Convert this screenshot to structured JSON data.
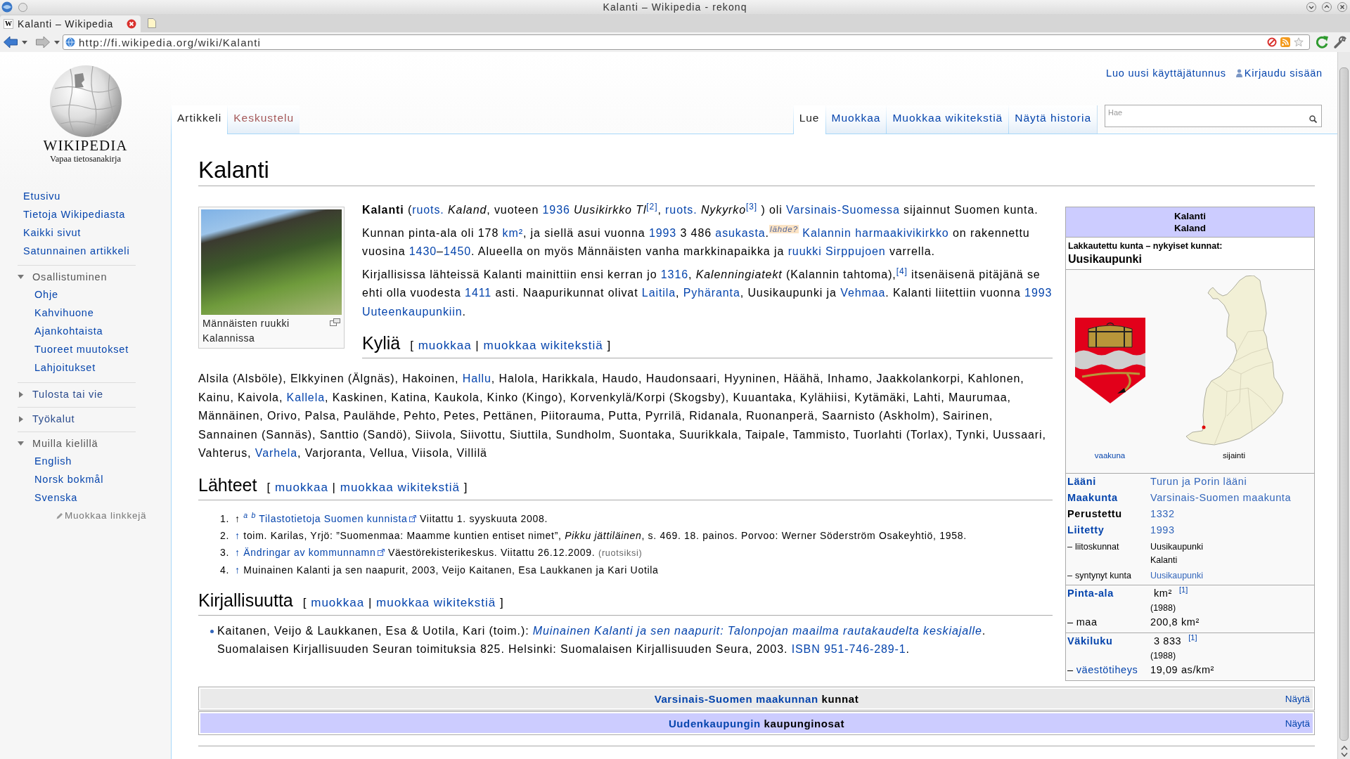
{
  "window": {
    "title": "Kalanti – Wikipedia - rekonq"
  },
  "browser_tabs": [
    {
      "icon": "W",
      "title": "Kalanti – Wikipedia",
      "selected": true
    }
  ],
  "address_bar": {
    "url": "http://fi.wikipedia.org/wiki/Kalanti"
  },
  "logo": {
    "wordmark": "WIKIPEDIA",
    "tagline": "Vapaa tietosanakirja"
  },
  "sidebar": {
    "links": [
      "Etusivu",
      "Tietoja Wikipediasta",
      "Kaikki sivut",
      "Satunnainen artikkeli"
    ],
    "sections": [
      {
        "title": "Osallistuminen",
        "expanded": true,
        "items": [
          "Ohje",
          "Kahvihuone",
          "Ajankohtaista",
          "Tuoreet muutokset",
          "Lahjoitukset"
        ]
      },
      {
        "title": "Tulosta tai vie",
        "expanded": false
      },
      {
        "title": "Työkalut",
        "expanded": false
      },
      {
        "title": "Muilla kielillä",
        "expanded": true,
        "items": [
          "English",
          "Norsk bokmål",
          "Svenska"
        ],
        "edit_link": "Muokkaa linkkejä"
      }
    ]
  },
  "personal_links": [
    {
      "kind": "plain",
      "label": "Luo uusi käyttäjätunnus"
    },
    {
      "kind": "user",
      "label": "Kirjaudu sisään"
    }
  ],
  "page_tabs": [
    {
      "label": "Artikkeli",
      "selected": true,
      "exists": true
    },
    {
      "label": "Keskustelu",
      "selected": false,
      "exists": false
    }
  ],
  "view_tabs": [
    {
      "label": "Lue",
      "selected": true
    },
    {
      "label": "Muokkaa",
      "selected": false
    },
    {
      "label": "Muokkaa wikitekstiä",
      "selected": false
    },
    {
      "label": "Näytä historia",
      "selected": false
    }
  ],
  "search": {
    "placeholder": "Hae"
  },
  "article": {
    "title": "Kalanti",
    "figure": {
      "caption": "Männäisten ruukki Kalannissa"
    },
    "intro": [
      [
        {
          "kind": "text",
          "text": "**Kalanti** ("
        },
        {
          "kind": "link",
          "text": "ruots."
        },
        {
          "kind": "text",
          "text": " *Kaland*, vuoteen "
        },
        {
          "kind": "link",
          "text": "1936"
        },
        {
          "kind": "text",
          "text": " *Uusikirkko Tl*"
        },
        {
          "kind": "link",
          "text": "$^{[2]}$"
        },
        {
          "kind": "text",
          "text": ", "
        },
        {
          "kind": "link",
          "text": "ruots."
        },
        {
          "kind": "text",
          "text": " *Nykyrko*"
        },
        {
          "kind": "link",
          "text": "$^{[3]}$"
        },
        {
          "kind": "text",
          "text": " ) oli "
        },
        {
          "kind": "link",
          "text": "Varsinais-Suomessa"
        },
        {
          "kind": "text",
          "text": " sijainnut Suomen kunta."
        }
      ],
      [
        {
          "kind": "text",
          "text": "Kunnan pinta-ala oli 178 "
        },
        {
          "kind": "link",
          "text": "km²"
        },
        {
          "kind": "text",
          "text": ", ja siellä asui vuonna "
        },
        {
          "kind": "link",
          "text": "1993"
        },
        {
          "kind": "text",
          "text": " 3 486 "
        },
        {
          "kind": "link",
          "text": "asukasta"
        },
        {
          "kind": "text",
          "text": "."
        },
        {
          "kind": "tag",
          "text": "lähde?"
        },
        {
          "kind": "link",
          "text": "Kalannin harmaakivikirkko",
          "space_before": true
        },
        {
          "kind": "text",
          "text": " on rakennettu vuosina "
        },
        {
          "kind": "link",
          "text": "1430"
        },
        {
          "kind": "text",
          "text": "–"
        },
        {
          "kind": "link",
          "text": "1450"
        },
        {
          "kind": "text",
          "text": ". Alueella on myös Männäisten vanha markkinapaikka ja "
        },
        {
          "kind": "link",
          "text": "ruukki Sirppujoen"
        },
        {
          "kind": "text",
          "text": " varrella."
        }
      ],
      [
        {
          "kind": "text",
          "text": "Kirjallisissa lähteissä Kalanti mainittiin ensi kerran jo "
        },
        {
          "kind": "link",
          "text": "1316"
        },
        {
          "kind": "text",
          "text": ", *Kalenningiatekt* (Kalannin tahtoma),"
        },
        {
          "kind": "link",
          "text": "$^{[4]}$"
        },
        {
          "kind": "text",
          "text": " itsenäisenä pitäjänä se ehti olla vuodesta "
        },
        {
          "kind": "link",
          "text": "1411"
        },
        {
          "kind": "text",
          "text": " asti. Naapurikunnat olivat "
        },
        {
          "kind": "link",
          "text": "Laitila"
        },
        {
          "kind": "text",
          "text": ", "
        },
        {
          "kind": "link",
          "text": "Pyhäranta"
        },
        {
          "kind": "text",
          "text": ", Uusikaupunki ja "
        },
        {
          "kind": "link",
          "text": "Vehmaa"
        },
        {
          "kind": "text",
          "text": ". Kalanti liitettiin vuonna "
        },
        {
          "kind": "link",
          "text": "1993"
        },
        {
          "kind": "link",
          "text": "Uuteenkaupunkiin",
          "space_before": true
        },
        {
          "kind": "text",
          "text": "."
        }
      ]
    ],
    "sections": [
      {
        "heading": "Kyliä",
        "edit": [
          {
            "kind": "text",
            "text": "[ "
          },
          {
            "kind": "link",
            "text": "muokkaa"
          },
          {
            "kind": "text",
            "text": " | "
          },
          {
            "kind": "link",
            "text": "muokkaa wikitekstiä"
          },
          {
            "kind": "text",
            "text": " ]"
          }
        ],
        "kind": "paragraph",
        "content": [
          {
            "kind": "text",
            "text": "Alsila (Alsböle), Elkkyinen (Älgnäs), Hakoinen, "
          },
          {
            "kind": "link",
            "text": "Hallu"
          },
          {
            "kind": "text",
            "text": ", Halola, Harikkala, Haudo, Haudonsaari, Hyyninen, Häähä, Inhamo, Jaakkolankorpi, Kahlonen, Kainu, Kaivola, "
          },
          {
            "kind": "link",
            "text": "Kallela"
          },
          {
            "kind": "text",
            "text": ", Kaskinen, Katina, Kaukola, Kinko (Kingo), Korvenkylä/Korpi (Skogsby), Kuuantaka, Kylähiisi, Kytämäki, Lahti, Maurumaa, Männäinen, Orivo, Palsa, Paulähde, Pehto, Petes, Pettänen, Piitorauma, Putta, Pyrrilä, Ridanala, Ruonanperä, Saarnisto (Askholm), Sairinen, Sannainen (Sannäs), Santtio (Sandö), Siivola, Siivottu, Siuttila, Sundholm, Suontaka, Suurikkala, Taipale, Tammisto, Tuorlahti (Torlax), Tynki, Uussaari, Vahterus, "
          },
          {
            "kind": "link",
            "text": "Varhela"
          },
          {
            "kind": "text",
            "text": ", Varjoranta, Vellua, Viisola, Villilä"
          }
        ]
      },
      {
        "heading": "Lähteet",
        "edit": [
          {
            "kind": "text",
            "text": "[ "
          },
          {
            "kind": "link",
            "text": "muokkaa"
          },
          {
            "kind": "text",
            "text": " | "
          },
          {
            "kind": "link",
            "text": "muokkaa wikitekstiä"
          },
          {
            "kind": "text",
            "text": " ]"
          }
        ],
        "kind": "references",
        "items": [
          {
            "number": "1.",
            "segments": [
              {
                "kind": "text",
                "text": "↑ "
              },
              {
                "kind": "backlink",
                "text": "a"
              },
              {
                "kind": "backlink",
                "text": "b",
                "space_before": true
              },
              {
                "kind": "external",
                "text": "Tilastotietoja Suomen kunnista",
                "space_before": true
              },
              {
                "kind": "text",
                "text": " Viitattu 1. syyskuuta 2008."
              }
            ]
          },
          {
            "number": "2.",
            "segments": [
              {
                "kind": "link",
                "text": "↑"
              },
              {
                "kind": "text",
                "text": " toim. Karilas, Yrjö: ”Suomenmaa: Maamme kuntien entiset nimet”, *Pikku jättiläinen*, s. 469. 18. painos. Porvoo: Werner Söderström Osakeyhtiö, 1958."
              }
            ]
          },
          {
            "number": "3.",
            "segments": [
              {
                "kind": "link",
                "text": "↑"
              },
              {
                "kind": "external",
                "text": "Ändringar av kommunnamn",
                "space_before": true
              },
              {
                "kind": "text",
                "text": " Väestörekisterikeskus. Viitattu 26.12.2009. "
              },
              {
                "kind": "note",
                "text": "(ruotsiksi)"
              }
            ]
          },
          {
            "number": "4.",
            "segments": [
              {
                "kind": "link",
                "text": "↑"
              },
              {
                "kind": "text",
                "text": " Muinainen Kalanti ja sen naapurit, 2003, Veijo Kaitanen, Esa Laukkanen ja Kari Uotila"
              }
            ]
          }
        ]
      },
      {
        "heading": "Kirjallisuutta",
        "edit": [
          {
            "kind": "text",
            "text": "[ "
          },
          {
            "kind": "link",
            "text": "muokkaa"
          },
          {
            "kind": "text",
            "text": " | "
          },
          {
            "kind": "link",
            "text": "muokkaa wikitekstiä"
          },
          {
            "kind": "text",
            "text": " ]"
          }
        ],
        "kind": "bullets",
        "items": [
          [
            {
              "kind": "text",
              "text": "Kaitanen, Veijo & Laukkanen, Esa & Uotila, Kari (toim.): "
            },
            {
              "kind": "link",
              "text": "*Muinainen Kalanti ja sen naapurit: Talonpojan maailma rautakaudelta keskiajalle*"
            },
            {
              "kind": "text",
              "text": ". Suomalaisen Kirjallisuuden Seuran toimituksia 825. Helsinki: Suomalaisen Kirjallisuuden Seura, 2003. "
            },
            {
              "kind": "link",
              "text": "ISBN 951-746-289-1"
            },
            {
              "kind": "text",
              "text": "."
            }
          ]
        ]
      }
    ]
  },
  "infobox": {
    "title": "Kalanti",
    "subtitle": "Kaland",
    "status_label": "Lakkautettu kunta – nykyiset kunnat:",
    "status_value": "Uusikaupunki",
    "images": [
      {
        "kind": "coat-of-arms",
        "caption": "vaakuna",
        "caption_link": true
      },
      {
        "kind": "map",
        "caption": "sijainti",
        "caption_link": false
      }
    ],
    "groups": [
      [
        {
          "kind": "main",
          "label": "Lääni",
          "label_link": true,
          "values": [
            {
              "text": "Turun ja Porin lääni",
              "link": true
            }
          ]
        },
        {
          "kind": "main",
          "label": "Maakunta",
          "label_link": true,
          "values": [
            {
              "text": "Varsinais-Suomen maakunta",
              "link": true
            }
          ]
        },
        {
          "kind": "main",
          "label": "Perustettu",
          "label_link": false,
          "values": [
            {
              "text": "1332",
              "link": true
            }
          ]
        },
        {
          "kind": "main",
          "label": "Liitetty",
          "label_link": true,
          "values": [
            {
              "text": "1993",
              "link": true
            }
          ]
        },
        {
          "kind": "detail",
          "prefix": "–",
          "label": "liitoskunnat",
          "label_link": false,
          "values": [
            {
              "text": "Uusikaupunki",
              "link": false
            },
            {
              "text": "Kalanti",
              "link": false
            }
          ]
        },
        {
          "kind": "detail",
          "prefix": "–",
          "label": "syntynyt kunta",
          "label_link": false,
          "values": [
            {
              "text": "Uusikaupunki",
              "link": true
            }
          ]
        }
      ],
      [
        {
          "kind": "main",
          "label": "Pinta-ala",
          "label_link": true,
          "values": [
            {
              "text": "km²",
              "link": false
            }
          ],
          "ref": "[1]",
          "note": "(1988)"
        },
        {
          "kind": "sub",
          "prefix": "–",
          "label": "maa",
          "label_link": false,
          "values": [
            {
              "text": "200,8 km²",
              "link": false
            }
          ]
        }
      ],
      [
        {
          "kind": "main",
          "label": "Väkiluku",
          "label_link": true,
          "values": [
            {
              "text": "3 833",
              "link": false
            }
          ],
          "ref": "[1]",
          "note": "(1988)"
        },
        {
          "kind": "sub",
          "prefix": "–",
          "label": "väestötiheys",
          "label_link": true,
          "values": [
            {
              "text": "19,09 as/km²",
              "link": false
            }
          ]
        }
      ]
    ]
  },
  "navboxes": [
    {
      "color": "#eaeaea",
      "title": [
        {
          "kind": "link",
          "text": "Varsinais-Suomen maakunnan"
        },
        {
          "kind": "text",
          "text": " kunnat"
        }
      ],
      "toggle": "Näytä"
    },
    {
      "color": "#ccccff",
      "title": [
        {
          "kind": "link",
          "text": "Uudenkaupungin"
        },
        {
          "kind": "text",
          "text": " kaupunginosat"
        }
      ],
      "toggle": "Näytä"
    }
  ]
}
